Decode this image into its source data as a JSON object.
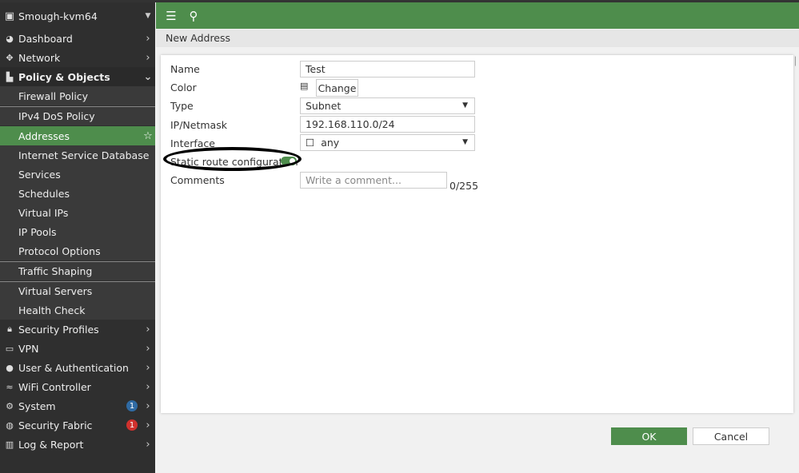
{
  "device": "Smough-kvm64",
  "sidebar": {
    "top": [
      {
        "label": "Dashboard",
        "icon": "dashboard-icon"
      },
      {
        "label": "Network",
        "icon": "network-icon"
      },
      {
        "label": "Policy & Objects",
        "icon": "policy-icon"
      }
    ],
    "sub": [
      "Firewall Policy",
      "IPv4 DoS Policy",
      "Addresses",
      "Internet Service Database",
      "Services",
      "Schedules",
      "Virtual IPs",
      "IP Pools",
      "Protocol Options",
      "Traffic Shaping",
      "Virtual Servers",
      "Health Check"
    ],
    "bottom": [
      {
        "label": "Security Profiles"
      },
      {
        "label": "VPN"
      },
      {
        "label": "User & Authentication"
      },
      {
        "label": "WiFi Controller"
      },
      {
        "label": "System",
        "badge": "1",
        "badge_color": "#2f6aa3"
      },
      {
        "label": "Security Fabric",
        "badge": "1",
        "badge_color": "#d0312d"
      },
      {
        "label": "Log & Report"
      }
    ]
  },
  "breadcrumb": "New Address",
  "form": {
    "name_label": "Name",
    "name_value": "Test",
    "color_label": "Color",
    "change_label": "Change",
    "type_label": "Type",
    "type_value": "Subnet",
    "ip_label": "IP/Netmask",
    "ip_value": "192.168.110.0/24",
    "interface_label": "Interface",
    "interface_value": "any",
    "static_label": "Static route configuration",
    "static_on": true,
    "comments_label": "Comments",
    "comments_placeholder": "Write a comment...",
    "comments_count": "0/255"
  },
  "ok_label": "OK",
  "cancel_label": "Cancel"
}
